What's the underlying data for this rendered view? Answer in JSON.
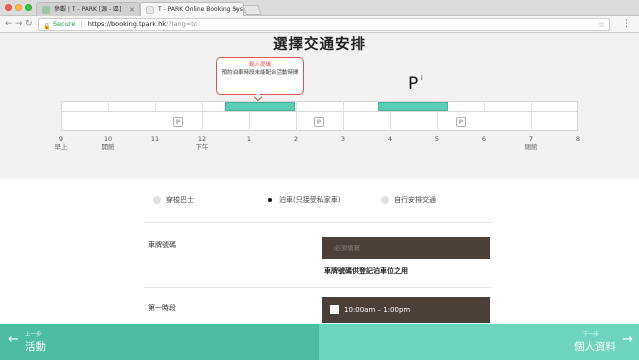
{
  "browser": {
    "tabs": [
      {
        "title": "參觀 | T - PARK [源 - 區]",
        "active": false
      },
      {
        "title": "T - PARK Online Booking Sys",
        "active": true
      }
    ],
    "secure_label": "Secure",
    "url_host": "https://booking.tpark.hk",
    "url_rest": "/?lang=tc",
    "back_icon": "back-arrow-icon",
    "forward_icon": "forward-arrow-icon",
    "reload_icon": "reload-icon"
  },
  "page": {
    "title": "選擇交通安排",
    "tooltip": {
      "title": "輸入提議",
      "body": "預約泊車時段未能配合活動時間"
    },
    "parking_mark": "P",
    "parking_mark_sup": "i",
    "timeline": {
      "tick_labels": [
        "9",
        "10",
        "11",
        "12",
        "1",
        "2",
        "3",
        "4",
        "5",
        "6",
        "7",
        "8"
      ],
      "tick_sub_labels": [
        "早上",
        "開館",
        "",
        "下午",
        "",
        "",
        "",
        "",
        "",
        "",
        "閉館",
        ""
      ],
      "parking_icon_label": "P"
    }
  },
  "form": {
    "transport_options": [
      {
        "label": "穿梭巴士",
        "selected": false
      },
      {
        "label": "泊車(只接受私家車)",
        "selected": true
      },
      {
        "label": "自行安排交通",
        "selected": false
      }
    ],
    "plate_label": "車牌號碼",
    "plate_placeholder": "必須填寫",
    "plate_note": "車牌號碼供登記泊車位之用",
    "slot_label": "第一時段",
    "slot_value": "10:00am – 1:00pm"
  },
  "footer": {
    "prev_small": "上一步",
    "prev_label": "活動",
    "next_small": "下一步",
    "next_label": "個人資料"
  },
  "colors": {
    "accent": "#4cbca3",
    "accent_light": "#6dd4bd",
    "timeline_fill": "#5ccdb3",
    "dark_field": "#4b3f3a",
    "alert": "#e0524a"
  }
}
